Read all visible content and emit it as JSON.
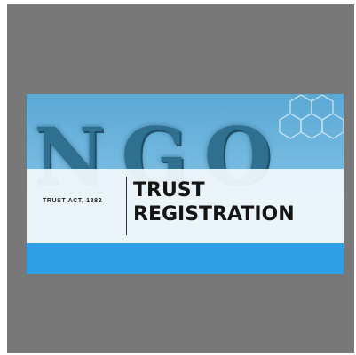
{
  "banner": {
    "watermark": "NGO",
    "act": "TRUST ACT, 1882",
    "title_line1": "TRUST",
    "title_line2": "REGISTRATION"
  },
  "colors": {
    "backdrop": "#787878",
    "sky_top": "#5aa9d6",
    "band": "#f0f6fa",
    "accent_bar": "#2f9fe8",
    "watermark": "#2f6f8f"
  },
  "icons": [
    "hexagon-pattern-icon"
  ]
}
